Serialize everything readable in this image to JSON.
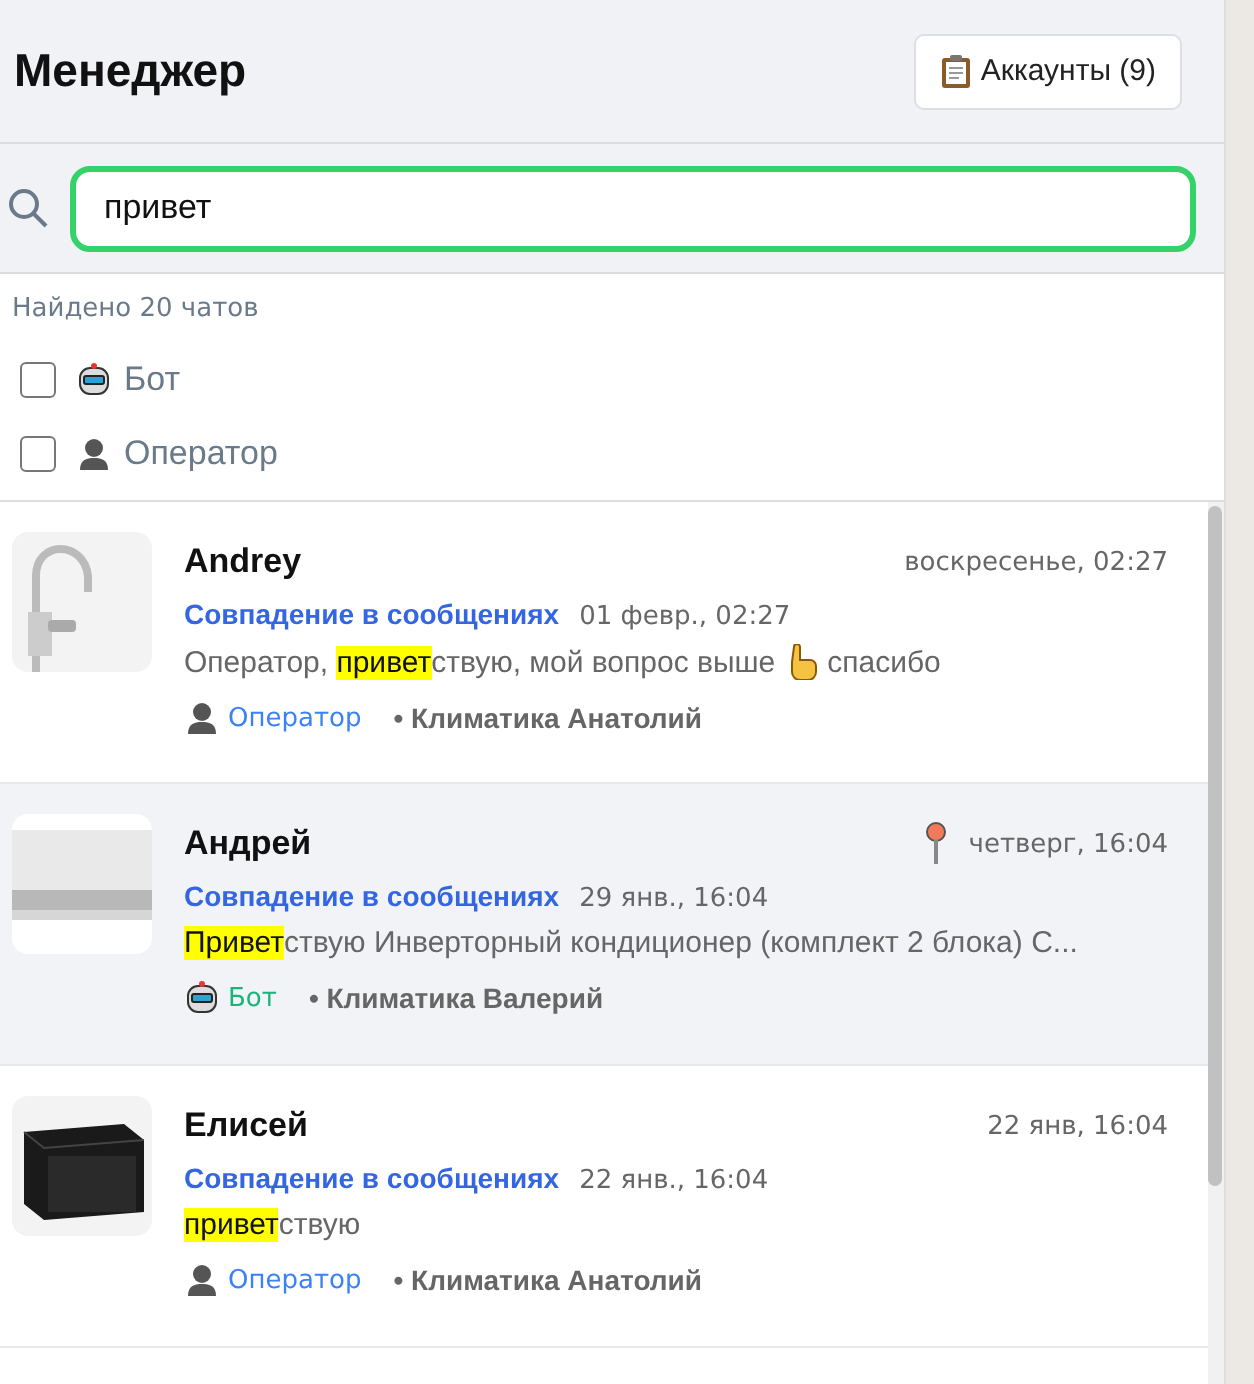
{
  "header": {
    "title": "Менеджер",
    "accounts_button": "Аккаунты (9)"
  },
  "search": {
    "value": "привет"
  },
  "found_count": "Найдено 20 чатов",
  "filters": [
    {
      "kind": "bot",
      "label": "Бот",
      "checked": false
    },
    {
      "kind": "operator",
      "label": "Оператор",
      "checked": false
    }
  ],
  "chats": [
    {
      "name": "Andrey",
      "time": "воскресенье, 02:27",
      "pinned": false,
      "selected": false,
      "match_label": "Совпадение в сообщениях",
      "match_time": "01 февр., 02:27",
      "message": [
        {
          "kind": "text",
          "text": "Оператор, "
        },
        {
          "kind": "match",
          "text": "привет"
        },
        {
          "kind": "text",
          "text": "ствую, мой вопрос выше"
        },
        {
          "kind": "hand"
        },
        {
          "kind": "text",
          "text": "спасибо"
        }
      ],
      "sender": {
        "kind": "operator",
        "label": "Оператор"
      },
      "account": "• Климатика Анатолий"
    },
    {
      "name": "Андрей",
      "time": "четверг, 16:04",
      "pinned": true,
      "selected": true,
      "match_label": "Совпадение в сообщениях",
      "match_time": "29 янв., 16:04",
      "message": [
        {
          "kind": "match",
          "text": "Привет"
        },
        {
          "kind": "text",
          "text": "ствую Инверторный кондиционер (комплект 2 блока) С..."
        }
      ],
      "sender": {
        "kind": "bot",
        "label": "Бот"
      },
      "account": "• Климатика Валерий"
    },
    {
      "name": "Елисей",
      "time": "22 янв, 16:04",
      "pinned": false,
      "selected": false,
      "match_label": "Совпадение в сообщениях",
      "match_time": "22 янв., 16:04",
      "message": [
        {
          "kind": "match",
          "text": "привет"
        },
        {
          "kind": "text",
          "text": "ствую"
        }
      ],
      "sender": {
        "kind": "operator",
        "label": "Оператор"
      },
      "account": "• Климатика Анатолий"
    }
  ]
}
